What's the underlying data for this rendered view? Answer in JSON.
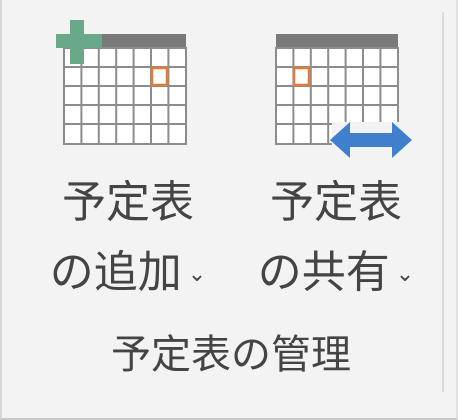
{
  "ribbon": {
    "group_label": "予定表の管理",
    "buttons": [
      {
        "id": "add",
        "line1": "予定表",
        "line2": "の追加",
        "chevron": "⌄",
        "icon": "calendar-add-icon"
      },
      {
        "id": "share",
        "line1": "予定表",
        "line2": "の共有",
        "chevron": "⌄",
        "icon": "calendar-share-icon"
      }
    ]
  },
  "colors": {
    "calendar_header": "#7a7a7a",
    "calendar_grid": "#8c8c8c",
    "accent_orange": "#e07b3a",
    "plus_green": "#6aa88a",
    "arrow_blue": "#3f7fcc",
    "text": "#444444"
  }
}
